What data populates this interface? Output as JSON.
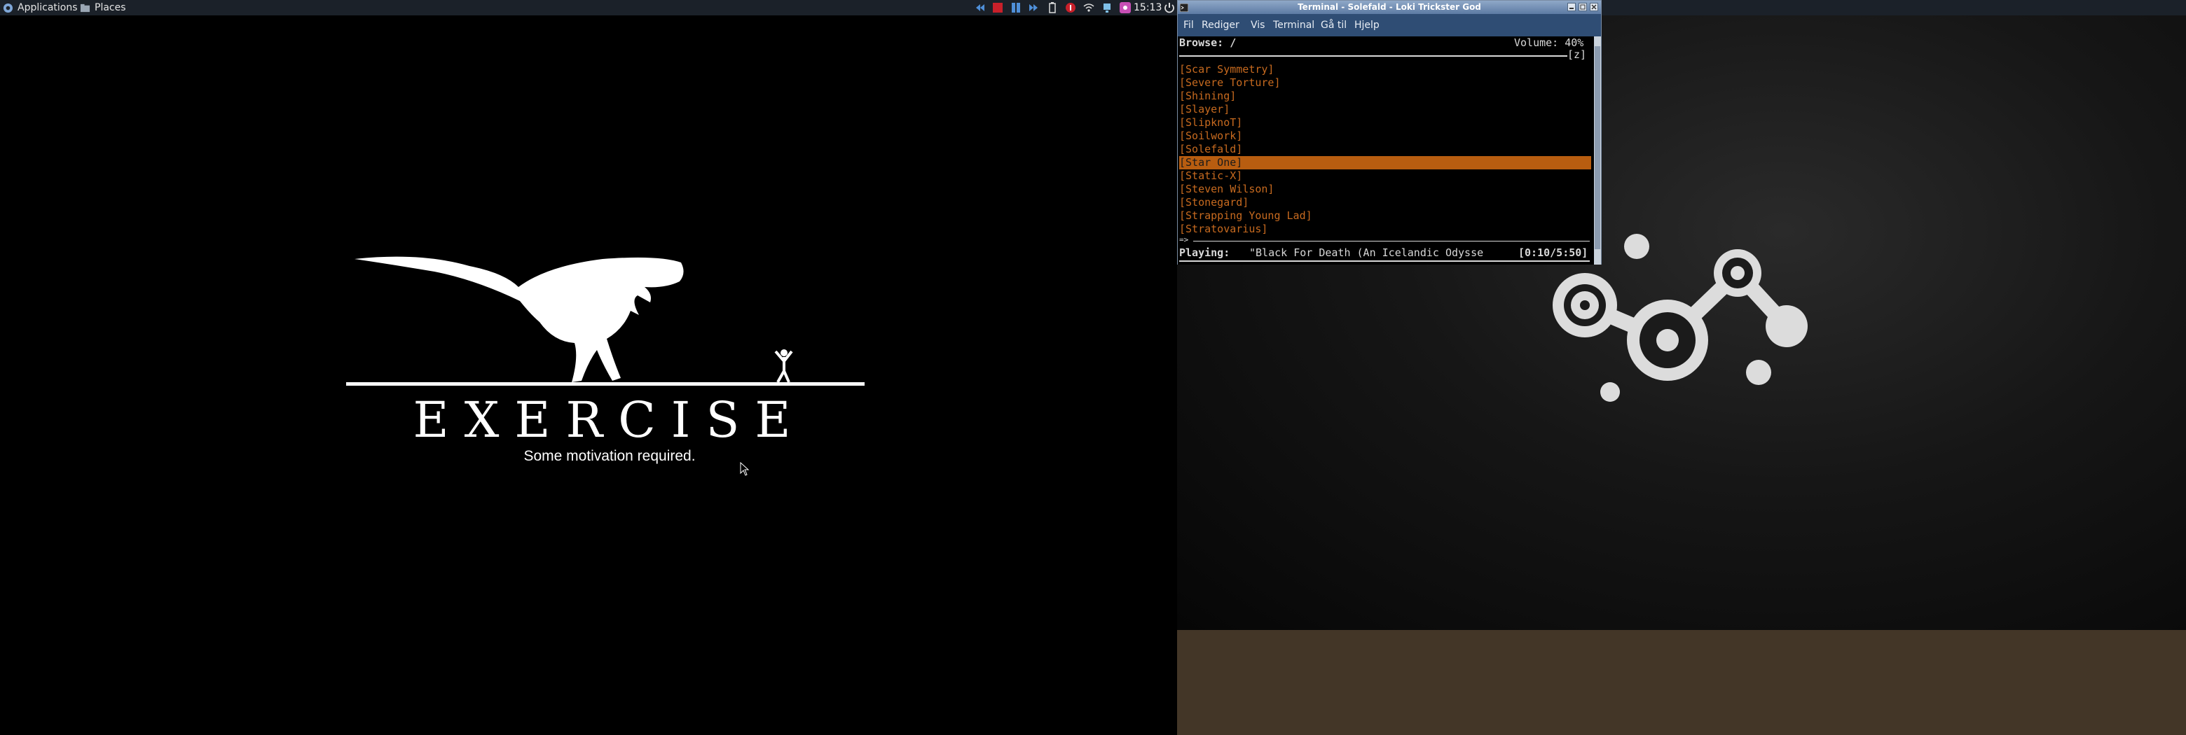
{
  "panel": {
    "applications_label": "Applications",
    "places_label": "Places",
    "clock": "15:13"
  },
  "poster": {
    "title": "EXERCISE",
    "subtitle": "Some motivation required."
  },
  "terminal": {
    "title": "Terminal - Solefald - Loki Trickster God",
    "menu": [
      "Fil",
      "Rediger",
      "Vis",
      "Terminal",
      "Gå til",
      "Hjelp"
    ],
    "browse": "Browse: /",
    "volume": "Volume: 40%",
    "view_tag": "[z]",
    "entries": [
      "[Scar Symmetry]",
      "[Severe Torture]",
      "[Shining]",
      "[Slayer]",
      "[SlipknoT]",
      "[Soilwork]",
      "[Solefald]",
      "[Star One]",
      "[Static-X]",
      "[Steven Wilson]",
      "[Stonegard]",
      "[Strapping Young Lad]",
      "[Stratovarius]"
    ],
    "selected_index": 7,
    "prompt": "=>",
    "playing_label": "Playing:",
    "playing_track": "\"Black For Death (An Icelandic Odysse",
    "playing_time": "[0:10/5:50]"
  },
  "colors": {
    "panel_bg": "#1b2129",
    "terminal_menubar": "#2f4d74",
    "entry_text": "#c76a1f",
    "selection_bg": "#b85d10",
    "floor": "#433627"
  }
}
